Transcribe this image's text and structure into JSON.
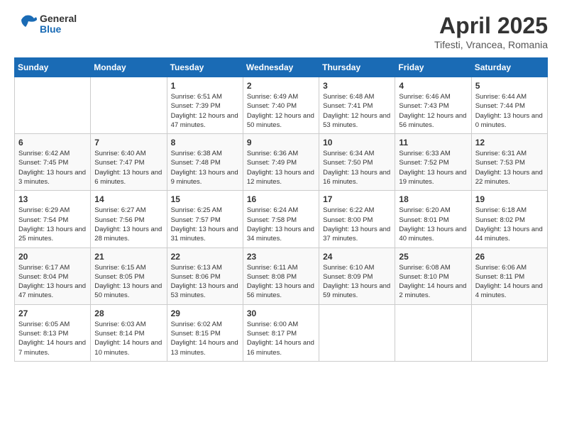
{
  "header": {
    "logo_general": "General",
    "logo_blue": "Blue",
    "title": "April 2025",
    "subtitle": "Tifesti, Vrancea, Romania"
  },
  "weekdays": [
    "Sunday",
    "Monday",
    "Tuesday",
    "Wednesday",
    "Thursday",
    "Friday",
    "Saturday"
  ],
  "weeks": [
    [
      {
        "day": "",
        "info": ""
      },
      {
        "day": "",
        "info": ""
      },
      {
        "day": "1",
        "info": "Sunrise: 6:51 AM\nSunset: 7:39 PM\nDaylight: 12 hours and 47 minutes."
      },
      {
        "day": "2",
        "info": "Sunrise: 6:49 AM\nSunset: 7:40 PM\nDaylight: 12 hours and 50 minutes."
      },
      {
        "day": "3",
        "info": "Sunrise: 6:48 AM\nSunset: 7:41 PM\nDaylight: 12 hours and 53 minutes."
      },
      {
        "day": "4",
        "info": "Sunrise: 6:46 AM\nSunset: 7:43 PM\nDaylight: 12 hours and 56 minutes."
      },
      {
        "day": "5",
        "info": "Sunrise: 6:44 AM\nSunset: 7:44 PM\nDaylight: 13 hours and 0 minutes."
      }
    ],
    [
      {
        "day": "6",
        "info": "Sunrise: 6:42 AM\nSunset: 7:45 PM\nDaylight: 13 hours and 3 minutes."
      },
      {
        "day": "7",
        "info": "Sunrise: 6:40 AM\nSunset: 7:47 PM\nDaylight: 13 hours and 6 minutes."
      },
      {
        "day": "8",
        "info": "Sunrise: 6:38 AM\nSunset: 7:48 PM\nDaylight: 13 hours and 9 minutes."
      },
      {
        "day": "9",
        "info": "Sunrise: 6:36 AM\nSunset: 7:49 PM\nDaylight: 13 hours and 12 minutes."
      },
      {
        "day": "10",
        "info": "Sunrise: 6:34 AM\nSunset: 7:50 PM\nDaylight: 13 hours and 16 minutes."
      },
      {
        "day": "11",
        "info": "Sunrise: 6:33 AM\nSunset: 7:52 PM\nDaylight: 13 hours and 19 minutes."
      },
      {
        "day": "12",
        "info": "Sunrise: 6:31 AM\nSunset: 7:53 PM\nDaylight: 13 hours and 22 minutes."
      }
    ],
    [
      {
        "day": "13",
        "info": "Sunrise: 6:29 AM\nSunset: 7:54 PM\nDaylight: 13 hours and 25 minutes."
      },
      {
        "day": "14",
        "info": "Sunrise: 6:27 AM\nSunset: 7:56 PM\nDaylight: 13 hours and 28 minutes."
      },
      {
        "day": "15",
        "info": "Sunrise: 6:25 AM\nSunset: 7:57 PM\nDaylight: 13 hours and 31 minutes."
      },
      {
        "day": "16",
        "info": "Sunrise: 6:24 AM\nSunset: 7:58 PM\nDaylight: 13 hours and 34 minutes."
      },
      {
        "day": "17",
        "info": "Sunrise: 6:22 AM\nSunset: 8:00 PM\nDaylight: 13 hours and 37 minutes."
      },
      {
        "day": "18",
        "info": "Sunrise: 6:20 AM\nSunset: 8:01 PM\nDaylight: 13 hours and 40 minutes."
      },
      {
        "day": "19",
        "info": "Sunrise: 6:18 AM\nSunset: 8:02 PM\nDaylight: 13 hours and 44 minutes."
      }
    ],
    [
      {
        "day": "20",
        "info": "Sunrise: 6:17 AM\nSunset: 8:04 PM\nDaylight: 13 hours and 47 minutes."
      },
      {
        "day": "21",
        "info": "Sunrise: 6:15 AM\nSunset: 8:05 PM\nDaylight: 13 hours and 50 minutes."
      },
      {
        "day": "22",
        "info": "Sunrise: 6:13 AM\nSunset: 8:06 PM\nDaylight: 13 hours and 53 minutes."
      },
      {
        "day": "23",
        "info": "Sunrise: 6:11 AM\nSunset: 8:08 PM\nDaylight: 13 hours and 56 minutes."
      },
      {
        "day": "24",
        "info": "Sunrise: 6:10 AM\nSunset: 8:09 PM\nDaylight: 13 hours and 59 minutes."
      },
      {
        "day": "25",
        "info": "Sunrise: 6:08 AM\nSunset: 8:10 PM\nDaylight: 14 hours and 2 minutes."
      },
      {
        "day": "26",
        "info": "Sunrise: 6:06 AM\nSunset: 8:11 PM\nDaylight: 14 hours and 4 minutes."
      }
    ],
    [
      {
        "day": "27",
        "info": "Sunrise: 6:05 AM\nSunset: 8:13 PM\nDaylight: 14 hours and 7 minutes."
      },
      {
        "day": "28",
        "info": "Sunrise: 6:03 AM\nSunset: 8:14 PM\nDaylight: 14 hours and 10 minutes."
      },
      {
        "day": "29",
        "info": "Sunrise: 6:02 AM\nSunset: 8:15 PM\nDaylight: 14 hours and 13 minutes."
      },
      {
        "day": "30",
        "info": "Sunrise: 6:00 AM\nSunset: 8:17 PM\nDaylight: 14 hours and 16 minutes."
      },
      {
        "day": "",
        "info": ""
      },
      {
        "day": "",
        "info": ""
      },
      {
        "day": "",
        "info": ""
      }
    ]
  ]
}
